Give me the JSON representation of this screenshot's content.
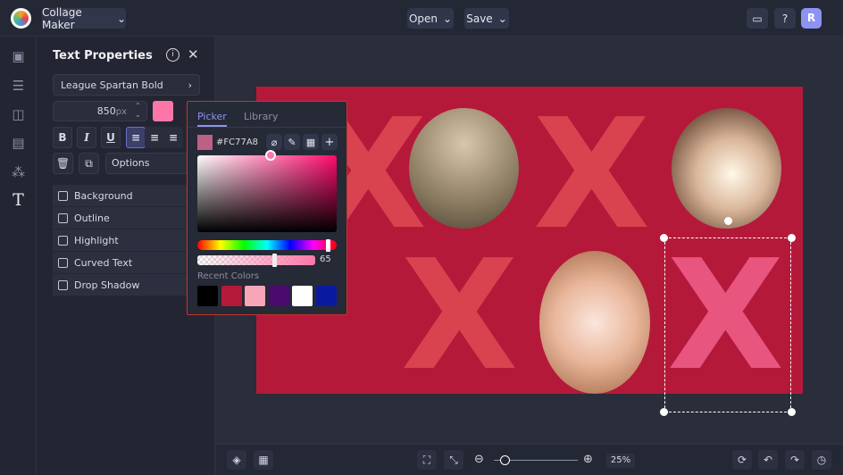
{
  "topbar": {
    "app_menu": "Collage Maker",
    "open": "Open",
    "save": "Save",
    "avatar": "R"
  },
  "panel": {
    "title": "Text Properties",
    "font": "League Spartan Bold",
    "size": "850",
    "size_unit": "px",
    "bold": "B",
    "italic": "I",
    "underline": "U",
    "options": "Options",
    "checkboxes": [
      "Background",
      "Outline",
      "Highlight",
      "Curved Text",
      "Drop Shadow"
    ]
  },
  "picker": {
    "tabs": [
      "Picker",
      "Library"
    ],
    "hex": "#FC77A8",
    "opacity": "65",
    "recent_label": "Recent Colors",
    "recent_colors": [
      "#000000",
      "#b5193a",
      "#f8a5b8",
      "#4a0a6e",
      "#ffffff",
      "#0a1aa0"
    ]
  },
  "canvas": {
    "background": "#b5193a",
    "letters": [
      "X",
      "X",
      "X",
      "X"
    ]
  },
  "bottombar": {
    "zoom": "25%",
    "zoom_level": 25
  }
}
